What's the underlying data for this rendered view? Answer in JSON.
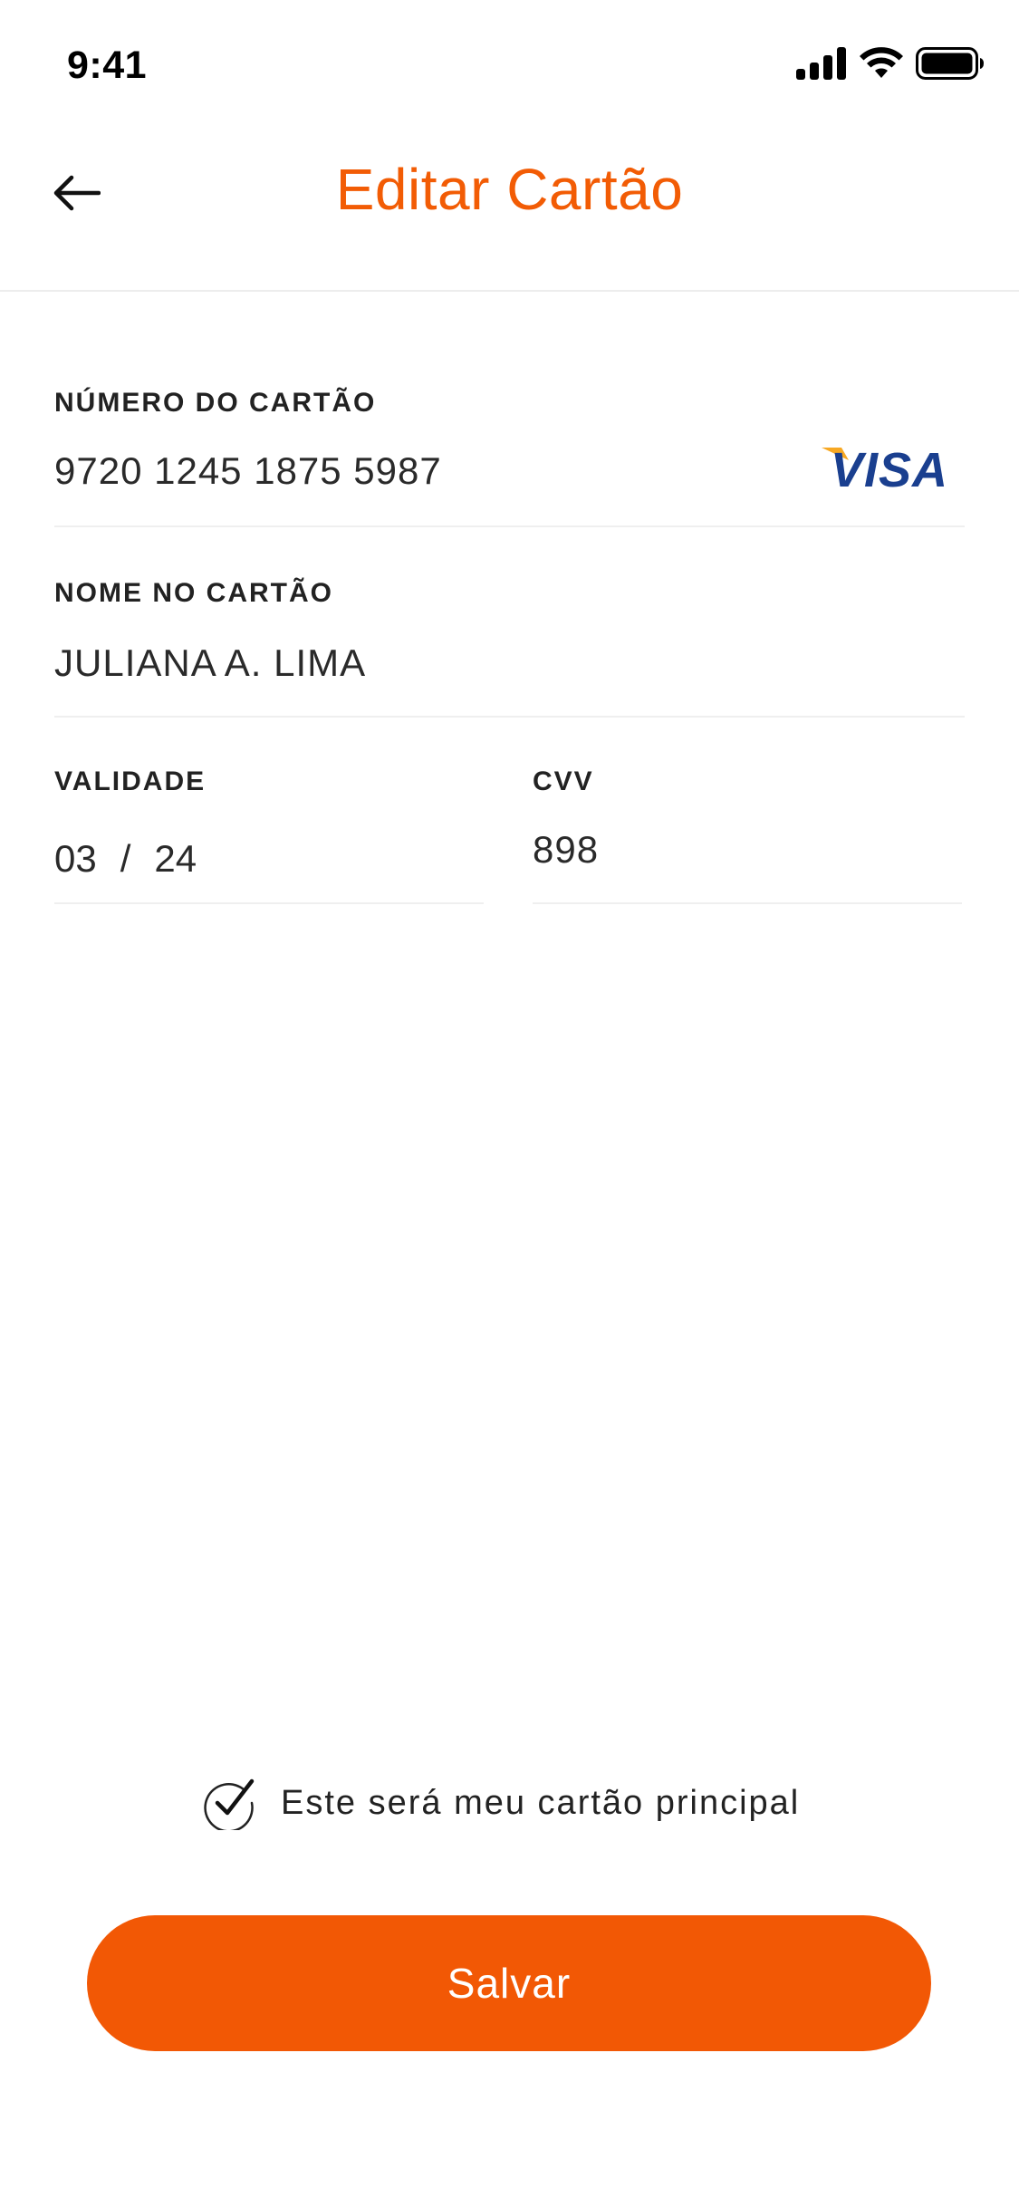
{
  "status_bar": {
    "time": "9:41",
    "icons": [
      "signal-icon",
      "wifi-icon",
      "battery-icon"
    ]
  },
  "header": {
    "back_icon": "arrow-left-icon",
    "title": "Editar Cartão"
  },
  "form": {
    "card_number": {
      "label": "NÚMERO DO CARTÃO",
      "value": "9720 1245 1875 5987",
      "brand": "VISA"
    },
    "card_name": {
      "label": "NOME NO CARTÃO",
      "value": "JULIANA A. LIMA"
    },
    "expiry": {
      "label": "VALIDADE",
      "month": "03",
      "separator": "/",
      "year": "24"
    },
    "cvv": {
      "label": "CVV",
      "value": "898"
    }
  },
  "default_card": {
    "checked": true,
    "label": "Este será meu cartão principal"
  },
  "save_button": {
    "label": "Salvar"
  },
  "colors": {
    "accent": "#f25805",
    "title": "#f25c05",
    "visa_blue": "#1a3f8f",
    "visa_gold": "#f7a823",
    "divider": "#efefef"
  }
}
